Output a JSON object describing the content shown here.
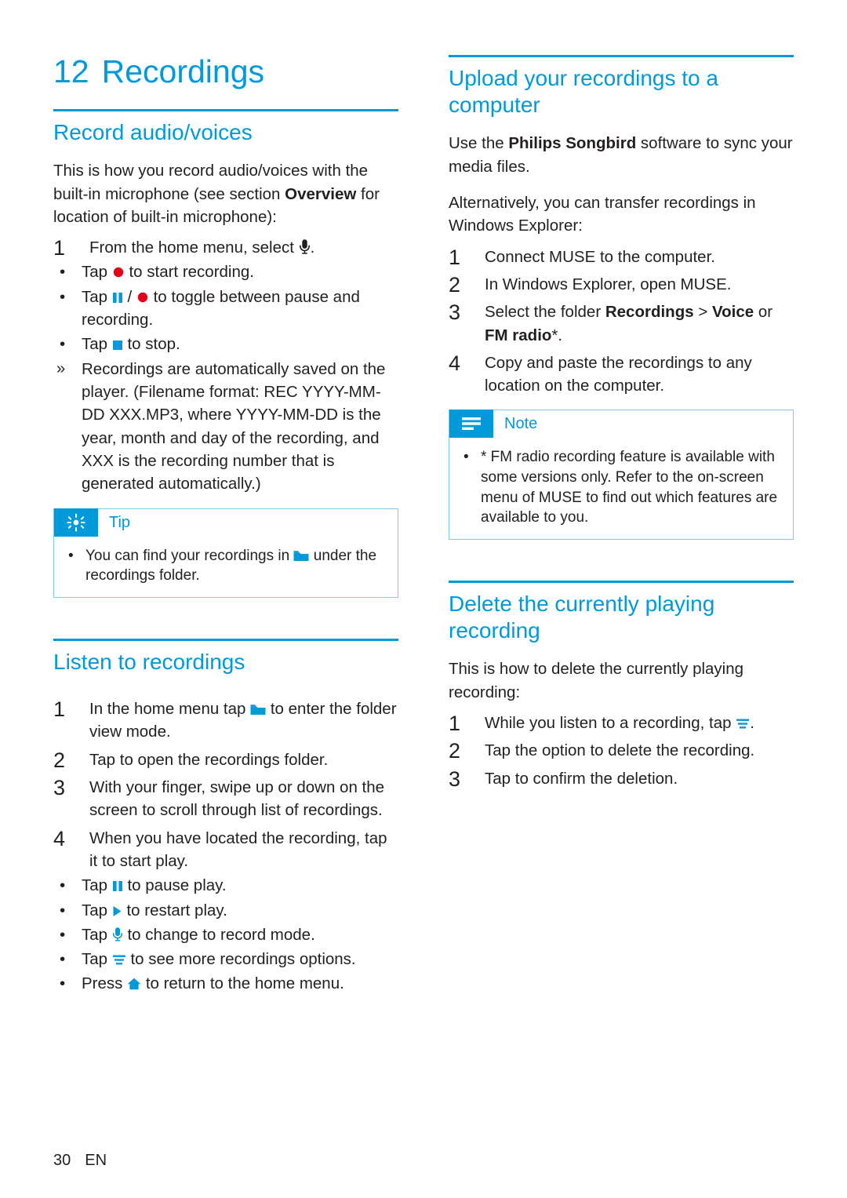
{
  "chapter": {
    "number": "12",
    "title": "Recordings"
  },
  "colors": {
    "accent": "#0099da",
    "text": "#231f20",
    "box_border": "#7fc9ea"
  },
  "left_column": {
    "sections": [
      {
        "title": "Record audio/voices",
        "intro": "This is how you record audio/voices with the built-in microphone (see section Overview for location of built-in microphone):",
        "intro_parts": {
          "a": "This is how you record audio/voices with the built-in microphone (see section ",
          "bold": "Overview",
          "b": " for location of built-in microphone):"
        },
        "steps": [
          {
            "n": "1",
            "text": "From the home menu, select",
            "icon": "microphone-icon",
            "trailing": "."
          }
        ],
        "bullets": [
          {
            "marker": "•",
            "pre": "Tap",
            "icon": "record-dot-icon",
            "post": "to start recording."
          },
          {
            "marker": "•",
            "pre": "Tap",
            "icon": "pause-icon",
            "mid": "/",
            "icon2": "record-dot-icon",
            "post": "to toggle between pause and recording."
          },
          {
            "marker": "•",
            "pre": "Tap",
            "icon": "stop-icon",
            "post": "to stop."
          },
          {
            "marker": "»",
            "pre": "",
            "post": "Recordings are automatically saved on the player. (Filename format: REC YYYY-MM-DD XXX.MP3, where YYYY-MM-DD is the year, month and day of the recording, and XXX is the recording number that is generated automatically.)"
          }
        ],
        "tip": {
          "label": "Tip",
          "icon": "tip-star-icon",
          "bullet_pre": "You can find your recordings in",
          "bullet_icon": "folder-icon",
          "bullet_post": "under the recordings folder."
        }
      },
      {
        "title": "Listen to recordings",
        "steps": [
          {
            "n": "1",
            "pre": "In the home menu tap",
            "icon": "folder-icon",
            "post": "to enter the folder view mode."
          },
          {
            "n": "2",
            "pre": "Tap to open the recordings folder.",
            "icon": "",
            "post": ""
          },
          {
            "n": "3",
            "pre": "With your finger, swipe up or down on the screen to scroll through list of recordings.",
            "icon": "",
            "post": ""
          },
          {
            "n": "4",
            "pre": "When you have located the recording, tap it to start play.",
            "icon": "",
            "post": ""
          }
        ],
        "bullets": [
          {
            "marker": "•",
            "pre": "Tap",
            "icon": "pause-icon",
            "post": "to pause play."
          },
          {
            "marker": "•",
            "pre": "Tap",
            "icon": "play-icon",
            "post": "to restart play."
          },
          {
            "marker": "•",
            "pre": "Tap",
            "icon": "microphone-icon",
            "post": "to change to record mode."
          },
          {
            "marker": "•",
            "pre": "Tap",
            "icon": "options-list-icon",
            "post": "to see more recordings options."
          },
          {
            "marker": "•",
            "pre": "Press",
            "icon": "home-icon",
            "post": "to return to the home menu."
          }
        ]
      }
    ]
  },
  "right_column": {
    "sections": [
      {
        "title": "Upload your recordings to a computer",
        "paragraph1_parts": {
          "a": "Use the ",
          "bold": "Philips Songbird",
          "b": " software to sync your media files."
        },
        "paragraph2": "Alternatively, you can transfer recordings in Windows Explorer:",
        "steps": [
          {
            "n": "1",
            "text": "Connect MUSE to the computer."
          },
          {
            "n": "2",
            "text": "In Windows Explorer, open MUSE."
          },
          {
            "n": "3",
            "text": "Select the folder Recordings > Voice or FM radio*.",
            "parts": {
              "a": "Select the folder ",
              "b1": "Recordings",
              "mid": " > ",
              "b2": "Voice",
              "c": " or ",
              "b3": "FM radio",
              "d": "*."
            }
          },
          {
            "n": "4",
            "text": "Copy and paste the recordings to any location on the computer."
          }
        ],
        "note": {
          "label": "Note",
          "icon": "note-lines-icon",
          "bullet": "* FM radio recording feature is available with some versions only. Refer to the on-screen menu of MUSE to find out which features are available to you."
        }
      },
      {
        "title": "Delete the currently playing recording",
        "intro": "This is how to delete the currently playing recording:",
        "steps": [
          {
            "n": "1",
            "pre": "While you listen to a recording, tap",
            "icon": "options-list-icon",
            "post": "."
          },
          {
            "n": "2",
            "pre": "Tap the option to delete the recording.",
            "icon": "",
            "post": ""
          },
          {
            "n": "3",
            "pre": "Tap to confirm the deletion.",
            "icon": "",
            "post": ""
          }
        ]
      }
    ]
  },
  "footer": {
    "page_number": "30",
    "language": "EN"
  }
}
